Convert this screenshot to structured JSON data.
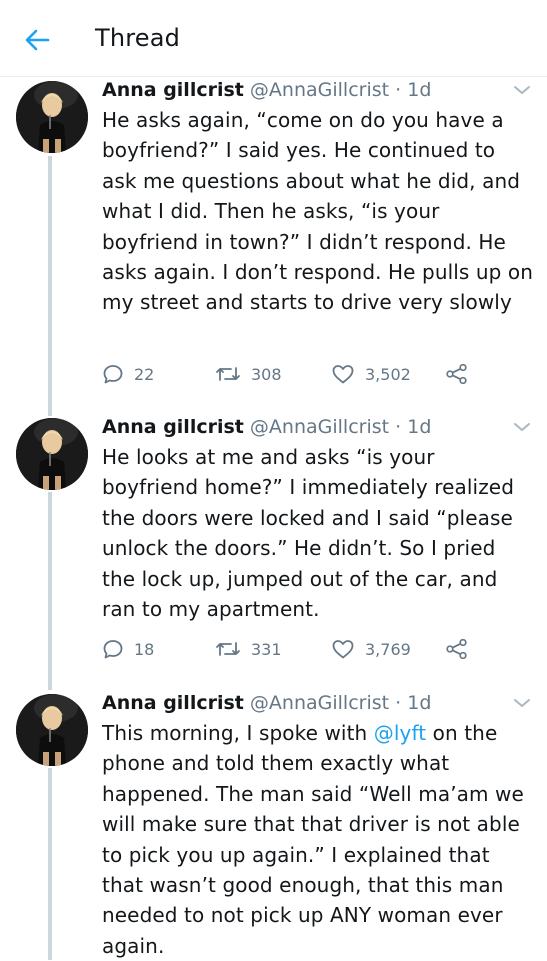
{
  "header": {
    "title": "Thread",
    "back_icon": "arrow-left-icon"
  },
  "colors": {
    "accent": "#1da1f2",
    "text": "#14171a",
    "secondary": "#657786",
    "thread_line": "#ccd6dd",
    "divider": "#e6ecf0"
  },
  "tweets": [
    {
      "name": "Anna gillcrist",
      "handle": "@AnnaGillcrist",
      "dot": "·",
      "time": "1d",
      "text": "He asks again, “come on do you have a boyfriend?” I said yes. He continued to ask me questions about what he did, and what I did. Then he asks, “is your boyfriend in town?” I didn’t respond. He asks again. I don’t respond. He pulls up on my street and starts to drive very slowly",
      "replies": "22",
      "retweets": "308",
      "likes": "3,502"
    },
    {
      "name": "Anna gillcrist",
      "handle": "@AnnaGillcrist",
      "dot": "·",
      "time": "1d",
      "text": "He looks at me and asks “is your boyfriend home?” I immediately realized the doors were locked and I said “please unlock the doors.” He didn’t. So I pried the lock up, jumped out of the car, and ran to my apartment.",
      "replies": "18",
      "retweets": "331",
      "likes": "3,769"
    },
    {
      "name": "Anna gillcrist",
      "handle": "@AnnaGillcrist",
      "dot": "·",
      "time": "1d",
      "text_before": "This morning, I spoke with ",
      "mention": "@lyft",
      "text_after": " on the phone and told them exactly what happened. The man said “Well ma’am we will make sure that that driver is not able to pick you up again.” I explained that that wasn’t good enough, that this man needed to not pick up ANY woman ever again."
    }
  ]
}
